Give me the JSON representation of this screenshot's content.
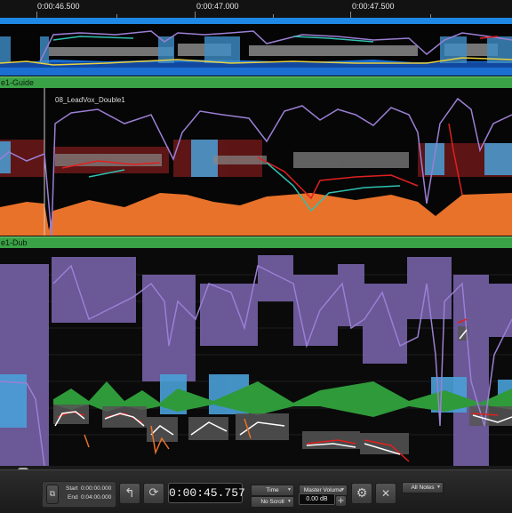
{
  "timeline": {
    "ticks": [
      "0:00:46.500",
      "0:00:47.000",
      "0:00:47.500"
    ]
  },
  "tracks": [
    {
      "name": "e1-Guide"
    },
    {
      "name": "e1-Dub"
    }
  ],
  "clip": {
    "label": "08_LeadVox_Double1"
  },
  "transport": {
    "start_label": "Start",
    "start_value": "0:00:00.000",
    "end_label": "End",
    "end_value": "0:04:00.000",
    "current_time": "0:00:45.757",
    "time_mode": "Time",
    "scroll_mode": "No Scroll",
    "master_volume_label": "Master Volume",
    "master_volume_value": "0.00 dB",
    "notes_filter": "All Notes"
  },
  "colors": {
    "selection_bar": "#1e88e5",
    "track_header": "#3aa246",
    "pitch_curve": "#9b7fd4",
    "waveform_orange": "#e8722a",
    "waveform_green": "#2f9a3a",
    "pitch_red": "#e02020",
    "pitch_teal": "#30c0b0",
    "pitch_yellow": "#e8d040"
  },
  "icons": [
    "rewind-icon",
    "loop-icon",
    "play-icon",
    "lock-icon",
    "close-icon",
    "plus-icon",
    "gear-icon"
  ]
}
